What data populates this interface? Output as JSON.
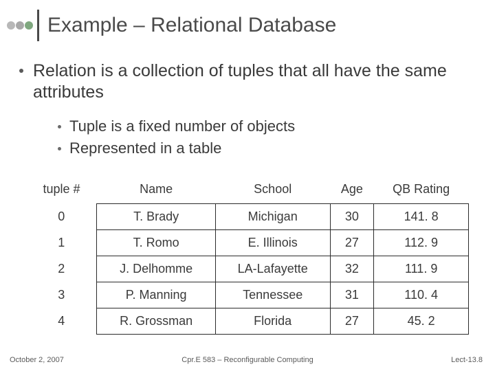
{
  "title": "Example – Relational Database",
  "bullets": {
    "main": "Relation is a collection of tuples that all have the same attributes",
    "sub1": "Tuple is a fixed number of objects",
    "sub2": "Represented in a table"
  },
  "table": {
    "headers": [
      "tuple #",
      "Name",
      "School",
      "Age",
      "QB Rating"
    ],
    "rows": [
      [
        "0",
        "T. Brady",
        "Michigan",
        "30",
        "141. 8"
      ],
      [
        "1",
        "T. Romo",
        "E. Illinois",
        "27",
        "112. 9"
      ],
      [
        "2",
        "J. Delhomme",
        "LA-Lafayette",
        "32",
        "111. 9"
      ],
      [
        "3",
        "P. Manning",
        "Tennessee",
        "31",
        "110. 4"
      ],
      [
        "4",
        "R. Grossman",
        "Florida",
        "27",
        "45. 2"
      ]
    ]
  },
  "footer": {
    "left": "October 2, 2007",
    "center": "Cpr.E 583 – Reconfigurable Computing",
    "right": "Lect-13.8"
  },
  "chart_data": {
    "type": "table",
    "title": "Relational Database example tuples",
    "columns": [
      "tuple #",
      "Name",
      "School",
      "Age",
      "QB Rating"
    ],
    "rows": [
      {
        "tuple #": 0,
        "Name": "T. Brady",
        "School": "Michigan",
        "Age": 30,
        "QB Rating": 141.8
      },
      {
        "tuple #": 1,
        "Name": "T. Romo",
        "School": "E. Illinois",
        "Age": 27,
        "QB Rating": 112.9
      },
      {
        "tuple #": 2,
        "Name": "J. Delhomme",
        "School": "LA-Lafayette",
        "Age": 32,
        "QB Rating": 111.9
      },
      {
        "tuple #": 3,
        "Name": "P. Manning",
        "School": "Tennessee",
        "Age": 31,
        "QB Rating": 110.4
      },
      {
        "tuple #": 4,
        "Name": "R. Grossman",
        "School": "Florida",
        "Age": 27,
        "QB Rating": 45.2
      }
    ]
  }
}
